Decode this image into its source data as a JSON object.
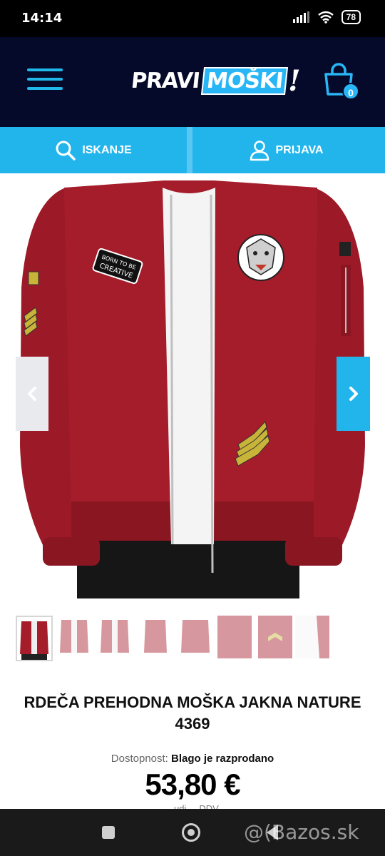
{
  "status_bar": {
    "time": "14:14",
    "battery": "78"
  },
  "header": {
    "logo": {
      "part1": "PRAVI",
      "part2": "MOŠKI",
      "part3": "!"
    },
    "cart_count": "0",
    "menu_icon": "hamburger-menu-icon",
    "cart_icon": "shopping-bag-icon"
  },
  "actions": {
    "search_label": "ISKANJE",
    "login_label": "PRIJAVA"
  },
  "product": {
    "title": "RDEČA PREHODNA MOŠKA JAKNA NATURE 4369",
    "availability_label": "Dostopnost:",
    "availability_value": "Blago je razprodano",
    "price": "53,80 €",
    "price_note": "...udi ... DDV",
    "image_patch_text": "BORN TO BE CREATIVE",
    "thumbnail_count": 8
  },
  "watermark": "@(Bazos.sk",
  "colors": {
    "header_bg": "#050a2a",
    "accent": "#22b5ec",
    "jacket": "#a51d2b"
  }
}
